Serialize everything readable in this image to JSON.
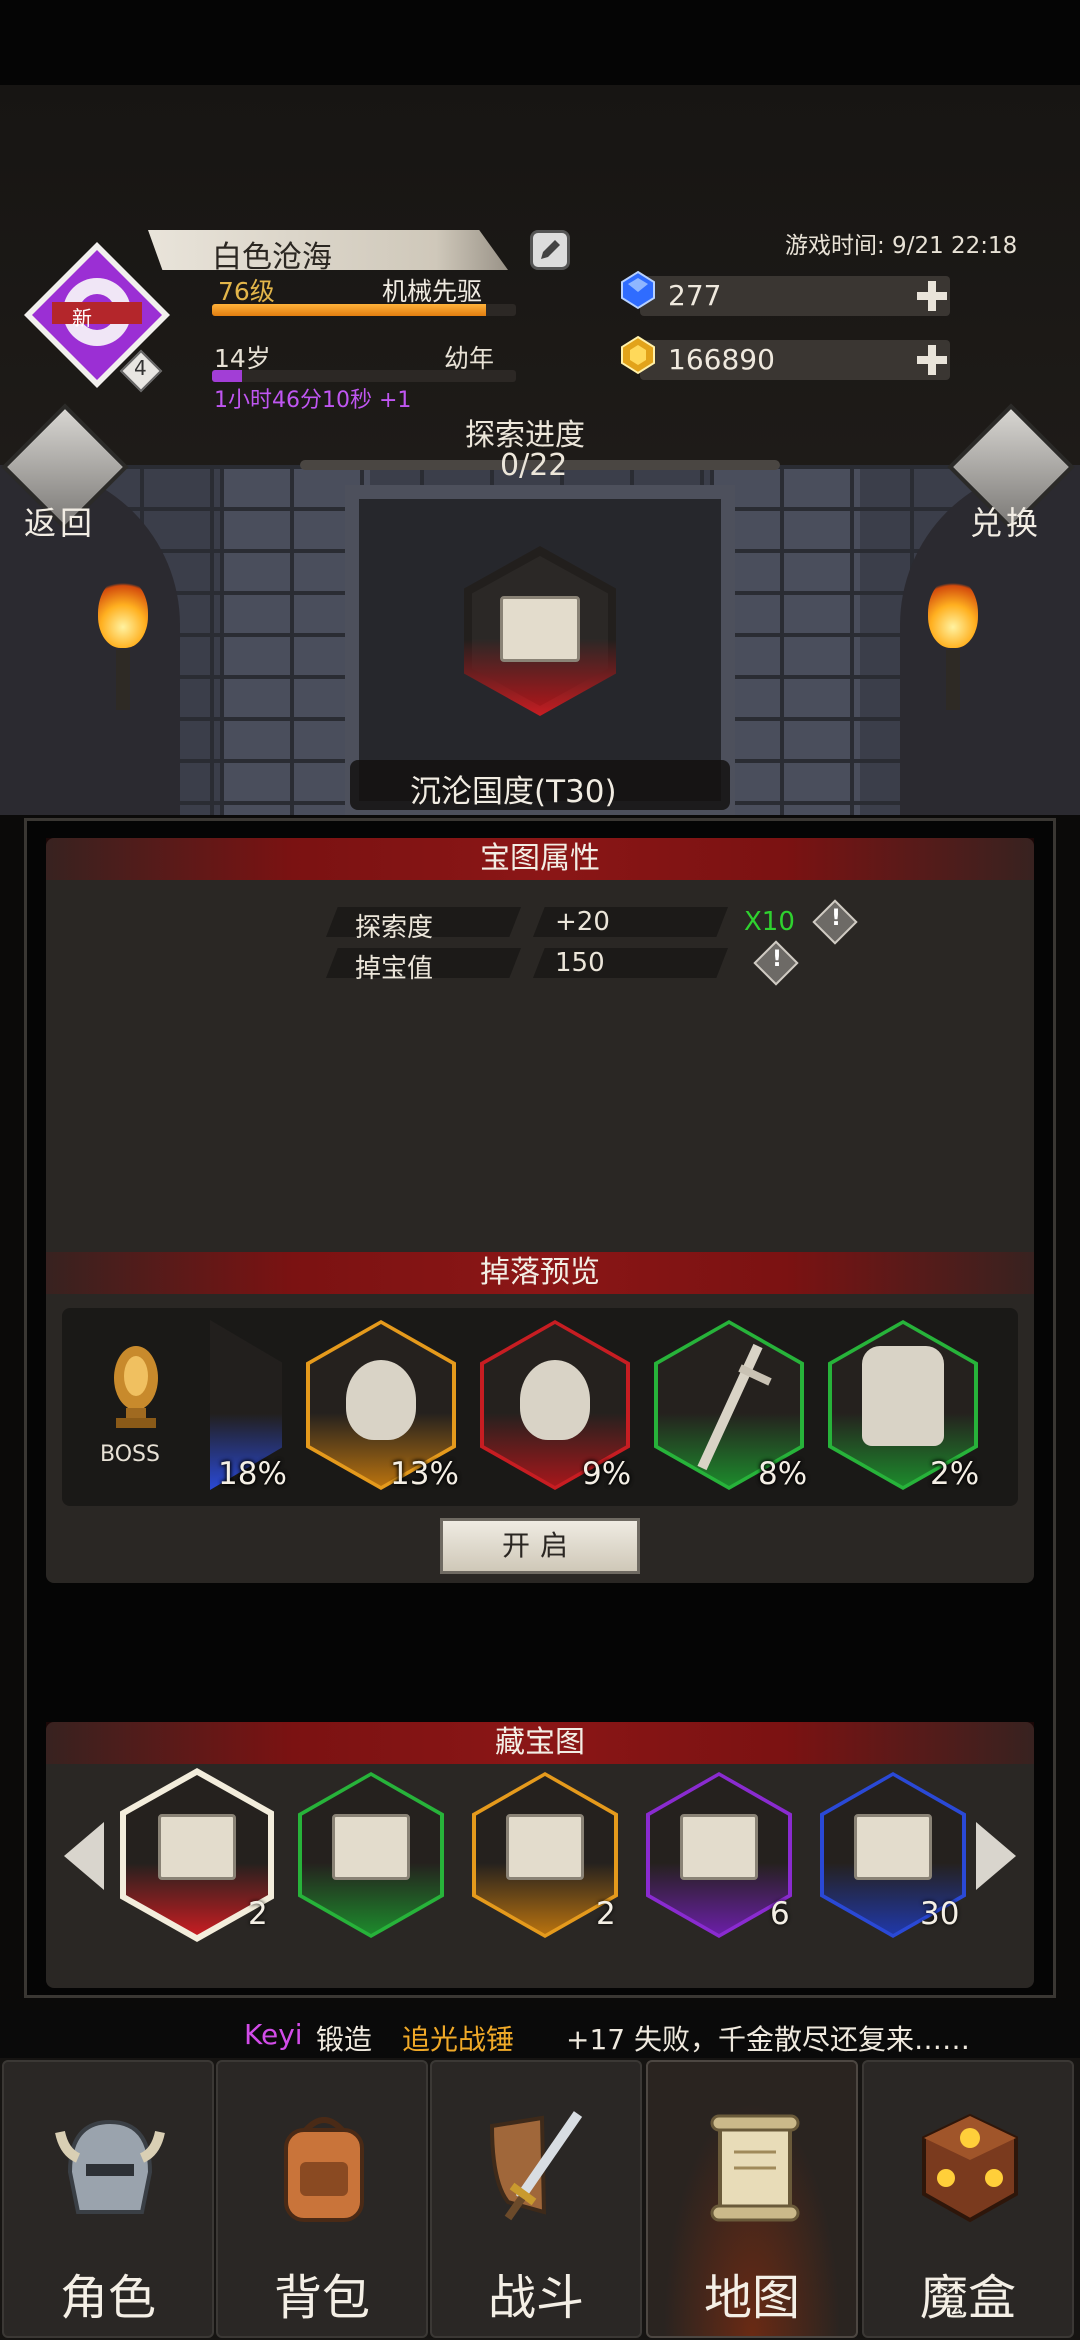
{
  "player": {
    "name": "白色沧海",
    "level": "76级",
    "class": "机械先驱",
    "level_progress": 0.9,
    "age": "14岁",
    "life_stage": "幼年",
    "age_progress": 0.1,
    "timer": "1小时46分10秒 +1",
    "avatar_badge": "新",
    "avatar_count": "4"
  },
  "game_time": "游戏时间: 9/21 22:18",
  "resources": {
    "gems": "277",
    "gold": "166890"
  },
  "nav": {
    "back_label": "返回",
    "exchange_label": "兑换"
  },
  "exploration": {
    "label": "探索进度",
    "value": "0/22"
  },
  "map_name": "沉沦国度(T30)",
  "map_attributes": {
    "title": "宝图属性",
    "rows": [
      {
        "label": "探索度",
        "value": "+20",
        "bonus": "X10"
      },
      {
        "label": "掉宝值",
        "value": "150",
        "bonus": ""
      }
    ]
  },
  "drop_preview": {
    "title": "掉落预览",
    "boss_label": "BOSS",
    "items": [
      {
        "pct": "18%",
        "rarity": "blue"
      },
      {
        "pct": "13%",
        "rarity": "orange"
      },
      {
        "pct": "9%",
        "rarity": "red"
      },
      {
        "pct": "8%",
        "rarity": "green"
      },
      {
        "pct": "2%",
        "rarity": "green"
      }
    ],
    "open_button": "开启"
  },
  "treasure_maps": {
    "title": "藏宝图",
    "items": [
      {
        "count": "2",
        "rarity": "red"
      },
      {
        "count": "",
        "rarity": "green"
      },
      {
        "count": "2",
        "rarity": "orange"
      },
      {
        "count": "6",
        "rarity": "purple"
      },
      {
        "count": "30",
        "rarity": "blue"
      }
    ]
  },
  "ticker": {
    "player": "Keyi",
    "action": "锻造",
    "item": "追光战锤",
    "rest": "+17 失败，千金散尽还复来……"
  },
  "bottom_nav": [
    {
      "label": "角色",
      "icon": "helmet-icon"
    },
    {
      "label": "背包",
      "icon": "backpack-icon"
    },
    {
      "label": "战斗",
      "icon": "sword-shield-icon"
    },
    {
      "label": "地图",
      "icon": "scroll-map-icon"
    },
    {
      "label": "魔盒",
      "icon": "magic-box-icon"
    }
  ],
  "colors": {
    "red": "#c71d22",
    "green": "#27b33a",
    "orange": "#e59a1c",
    "purple": "#8a2bd0",
    "blue": "#2a49d6",
    "accent_gold": "#e2b54a",
    "timer_purple": "#c056f2"
  }
}
